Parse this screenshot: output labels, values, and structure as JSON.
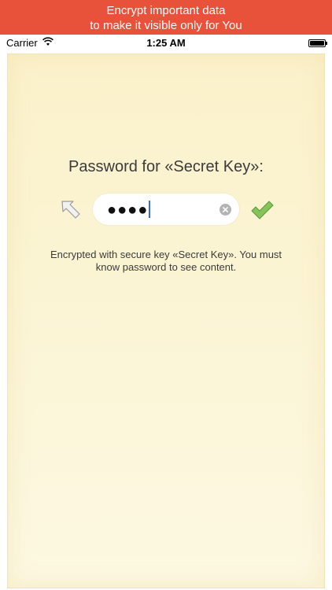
{
  "promo": {
    "line1": "Encrypt important data",
    "line2": "to make it visible only for You"
  },
  "status_bar": {
    "carrier": "Carrier",
    "time": "1:25 AM"
  },
  "lock_screen": {
    "title": "Password for «Secret Key»:",
    "password_value": "●●●●",
    "info": "Encrypted with secure key «Secret Key». You must know password to see content."
  },
  "icons": {
    "back": "arrow-up-left-icon",
    "clear": "clear-circle-icon",
    "confirm": "checkmark-icon",
    "wifi": "wifi-icon",
    "battery": "battery-icon"
  },
  "colors": {
    "banner": "#e8523a",
    "paper": "#fbf3d0",
    "confirm_green": "#7dbf4f",
    "caret": "#3d6bd6"
  }
}
